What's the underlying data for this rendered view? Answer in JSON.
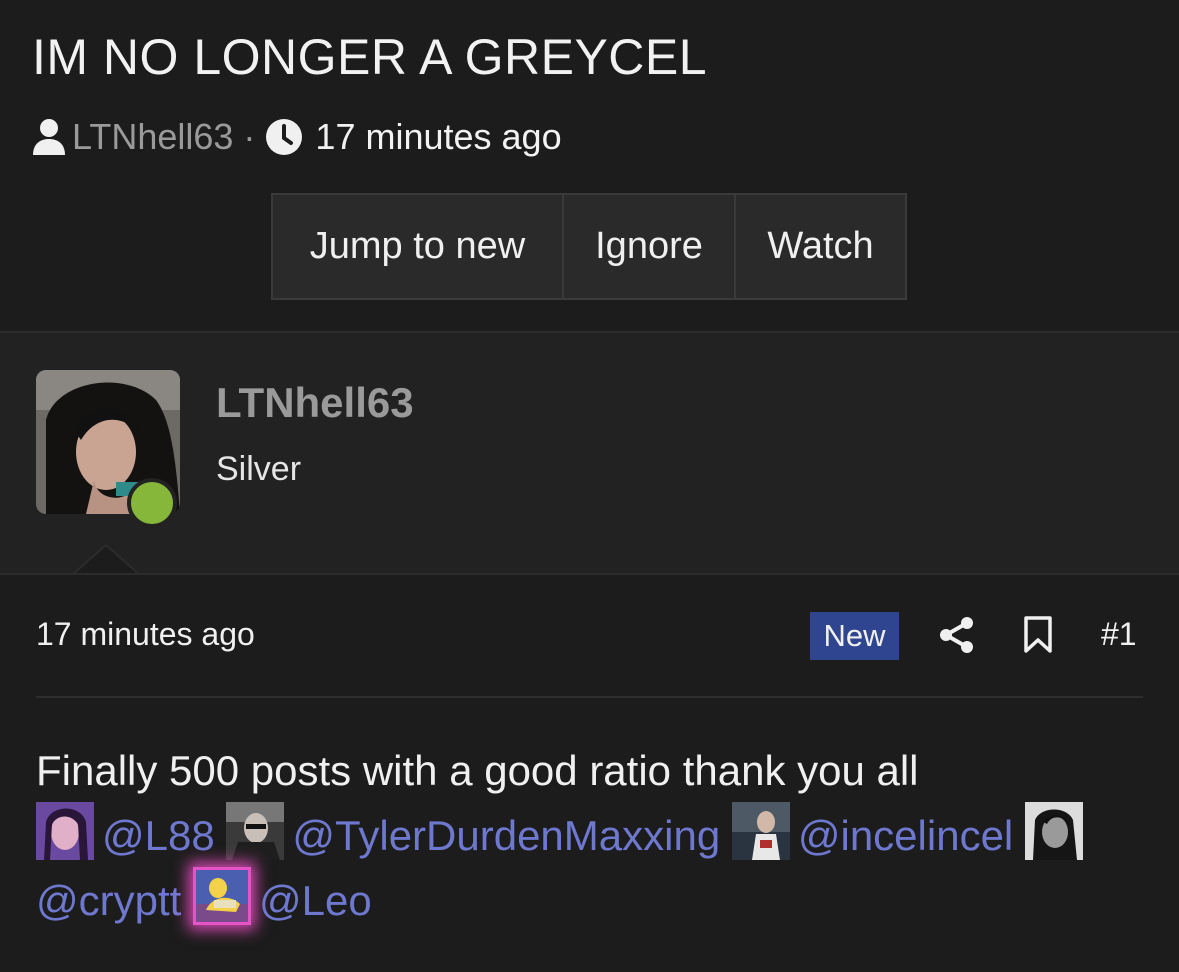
{
  "thread": {
    "title": "IM NO LONGER A GREYCEL",
    "author": "LTNhell63",
    "separator": "·",
    "time": "17 minutes ago",
    "author_icon": "user-icon",
    "time_icon": "clock-icon"
  },
  "actions": {
    "jump_label": "Jump to new",
    "ignore_label": "Ignore",
    "watch_label": "Watch"
  },
  "user": {
    "name": "LTNhell63",
    "title": "Silver",
    "online_color": "#86b63a"
  },
  "post": {
    "time": "17 minutes ago",
    "badge": "New",
    "badge_color": "#2f4590",
    "number": "#1",
    "share_icon": "share-icon",
    "bookmark_icon": "bookmark-icon",
    "text": "Finally 500 posts with a good ratio thank you all",
    "mention_color": "#6e78cf",
    "mentions": [
      "@L88",
      "@TylerDurdenMaxxing",
      "@incelincel",
      "@cryptt",
      "@Leo"
    ]
  }
}
